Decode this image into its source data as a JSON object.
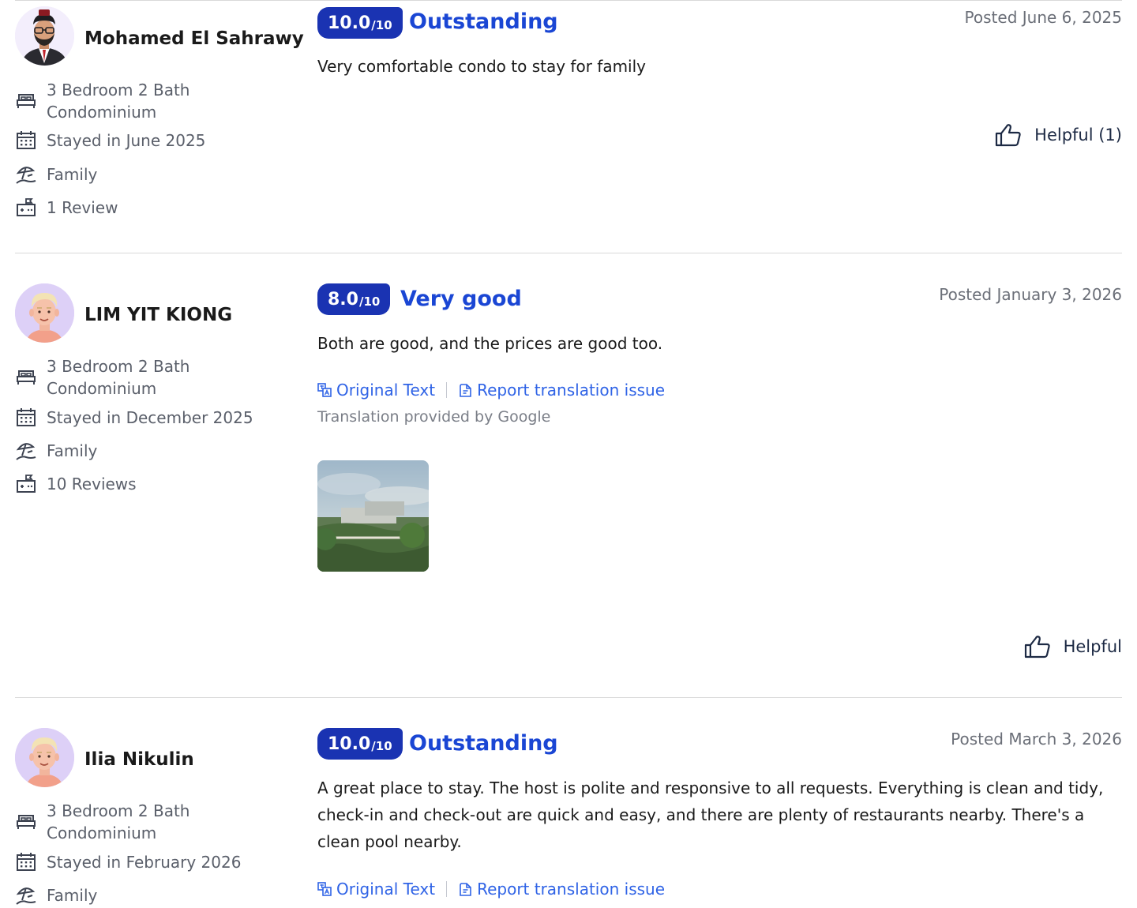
{
  "reviews": [
    {
      "name": "Mohamed El Sahrawy",
      "avatar": "man-with-glasses-avatar",
      "room": "3 Bedroom 2 Bath Condominium",
      "stayed": "Stayed in June 2025",
      "trip_type": "Family",
      "review_count": "1 Review",
      "score": "10.0",
      "score_max": "/10",
      "score_word": "Outstanding",
      "posted": "Posted June 6, 2025",
      "text": "Very comfortable condo to stay for family",
      "helpful": "Helpful (1)"
    },
    {
      "name": "LIM YIT KIONG",
      "avatar": "blond-cartoon-avatar",
      "room": "3 Bedroom 2 Bath Condominium",
      "stayed": "Stayed in December 2025",
      "trip_type": "Family",
      "review_count": "10 Reviews",
      "score": "8.0",
      "score_max": "/10",
      "score_word": "Very good",
      "posted": "Posted January 3, 2026",
      "text": "Both are good, and the prices are good too.",
      "original_text": "Original Text",
      "report_translation": "Report translation issue",
      "translation_note": "Translation provided by Google",
      "helpful": "Helpful"
    },
    {
      "name": "Ilia Nikulin",
      "avatar": "blond-cartoon-avatar",
      "room": "3 Bedroom 2 Bath Condominium",
      "stayed": "Stayed in February 2026",
      "trip_type": "Family",
      "score": "10.0",
      "score_max": "/10",
      "score_word": "Outstanding",
      "posted": "Posted March 3, 2026",
      "text": "A great place to stay. The host is polite and responsive to all requests. Everything is clean and tidy, check-in and check-out are quick and easy, and there are plenty of restaurants nearby. There's a clean pool nearby.",
      "original_text": "Original Text",
      "report_translation": "Report translation issue"
    }
  ],
  "colors": {
    "badge": "#1a33b2",
    "score_word": "#1a46d4",
    "link": "#2f63e6",
    "meta_text": "#5a5f6a"
  },
  "icons": {
    "room": "bed-icon",
    "stayed": "calendar-icon",
    "trip_type": "beach-umbrella-icon",
    "review_count": "review-count-icon",
    "helpful": "thumbs-up-icon",
    "original_text": "translate-icon",
    "report": "report-icon"
  }
}
